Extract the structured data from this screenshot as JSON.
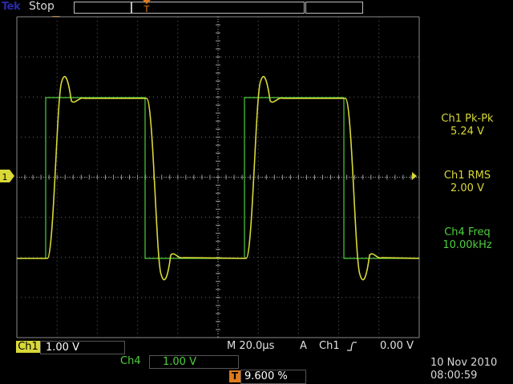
{
  "header": {
    "brand": "Tek",
    "run_state": "Stop"
  },
  "channels": {
    "ch1": {
      "label": "Ch1",
      "scale": "1.00 V",
      "color": "#d8d838",
      "marker": "1"
    },
    "ch4": {
      "label": "Ch4",
      "scale": "1.00 V",
      "color": "#4ecf3e"
    }
  },
  "measurements": [
    {
      "label": "Ch1 Pk-Pk",
      "value": "5.24 V",
      "channel": "ch1"
    },
    {
      "label": "Ch1 RMS",
      "value": "2.00 V",
      "channel": "ch1"
    },
    {
      "label": "Ch4 Freq",
      "value": "10.00kHz",
      "channel": "ch4"
    }
  ],
  "timebase": "M 20.0µs",
  "trigger": {
    "mode": "A",
    "source": "Ch1",
    "level": "0.00 V",
    "position_badge": "T",
    "position": "9.600 %",
    "marker_color": "#e07a1a"
  },
  "datetime": {
    "date": "10 Nov 2010",
    "time": "08:00:59"
  }
}
